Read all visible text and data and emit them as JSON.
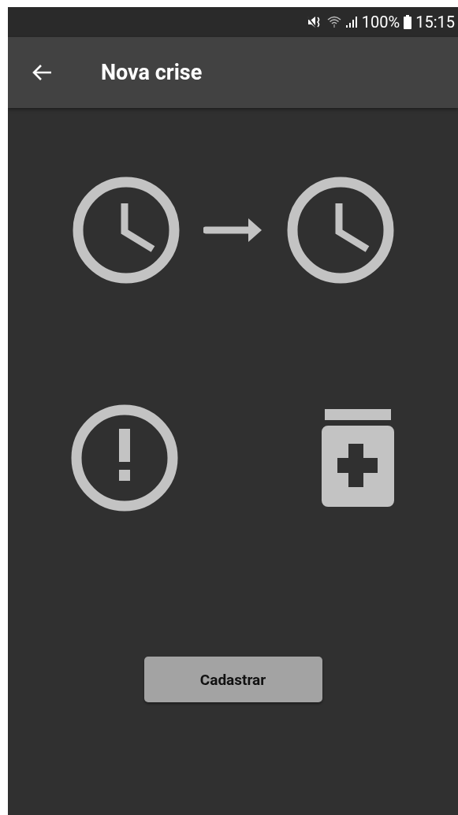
{
  "status_bar": {
    "battery": "100%",
    "time": "15:15"
  },
  "app_bar": {
    "title": "Nova crise"
  },
  "button": {
    "label": "Cadastrar"
  }
}
